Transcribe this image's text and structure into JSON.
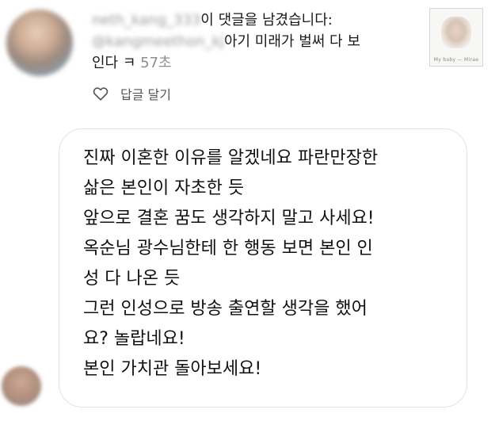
{
  "notification": {
    "username": "neth_kang_333",
    "action_text": "이 댓글을 남겼습니다:",
    "mention": "@kangmeethon_kj",
    "comment_preview_1": "아기 미래가 벌써 다 보",
    "comment_preview_2": "인다 ㅋ",
    "time": "57초"
  },
  "thumbnail": {
    "caption": "My baby — Mirae"
  },
  "actions": {
    "reply_label": "답글 달기"
  },
  "message": {
    "lines": [
      "진짜 이혼한 이유를 알겠네요 파란만장한",
      "삶은 본인이 자초한 듯",
      "앞으로 결혼 꿈도 생각하지 말고 사세요!",
      "옥순님 광수님한테 한 행동 보면 본인 인",
      "성 다 나온 듯",
      "그런 인성으로 방송 출연할 생각을 했어",
      "요? 놀랍네요!",
      "본인 가치관 돌아보세요!"
    ]
  },
  "colors": {
    "time_gray": "#8e8e8e",
    "bubble_border": "#e3e3e3",
    "text": "#111111"
  }
}
